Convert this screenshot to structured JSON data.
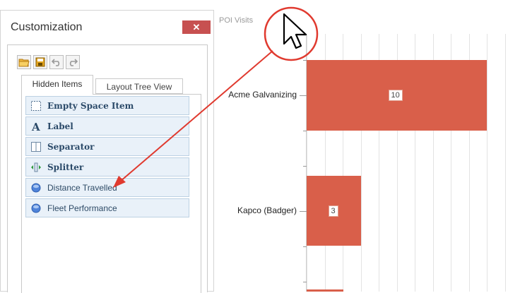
{
  "panel": {
    "title": "Customization",
    "close_label": "✕",
    "tabs": [
      "Hidden Items",
      "Layout Tree View"
    ],
    "items": [
      {
        "label": "Empty Space Item",
        "icon": "empty-space-icon",
        "bold": true
      },
      {
        "label": "Label",
        "icon": "label-a-icon",
        "bold": true
      },
      {
        "label": "Separator",
        "icon": "separator-icon",
        "bold": true
      },
      {
        "label": "Splitter",
        "icon": "splitter-icon",
        "bold": true
      },
      {
        "label": "Distance Travelled",
        "icon": "blue-circle-icon",
        "bold": false
      },
      {
        "label": "Fleet Performance",
        "icon": "blue-circle-icon",
        "bold": false
      }
    ]
  },
  "chart": {
    "title": "POI Visits",
    "bar_color": "#d95f4a"
  },
  "chart_data": {
    "type": "bar",
    "orientation": "horizontal",
    "title": "POI Visits",
    "categories": [
      "Acme Galvanizing",
      "Kapco (Badger)"
    ],
    "values": [
      10,
      3
    ],
    "value_labels": [
      "10",
      "3"
    ],
    "grid": true
  },
  "colors": {
    "accent_red": "#e03a2f",
    "close_button": "#c75050",
    "item_bg": "#e9f1f9",
    "bar": "#d95f4a"
  }
}
